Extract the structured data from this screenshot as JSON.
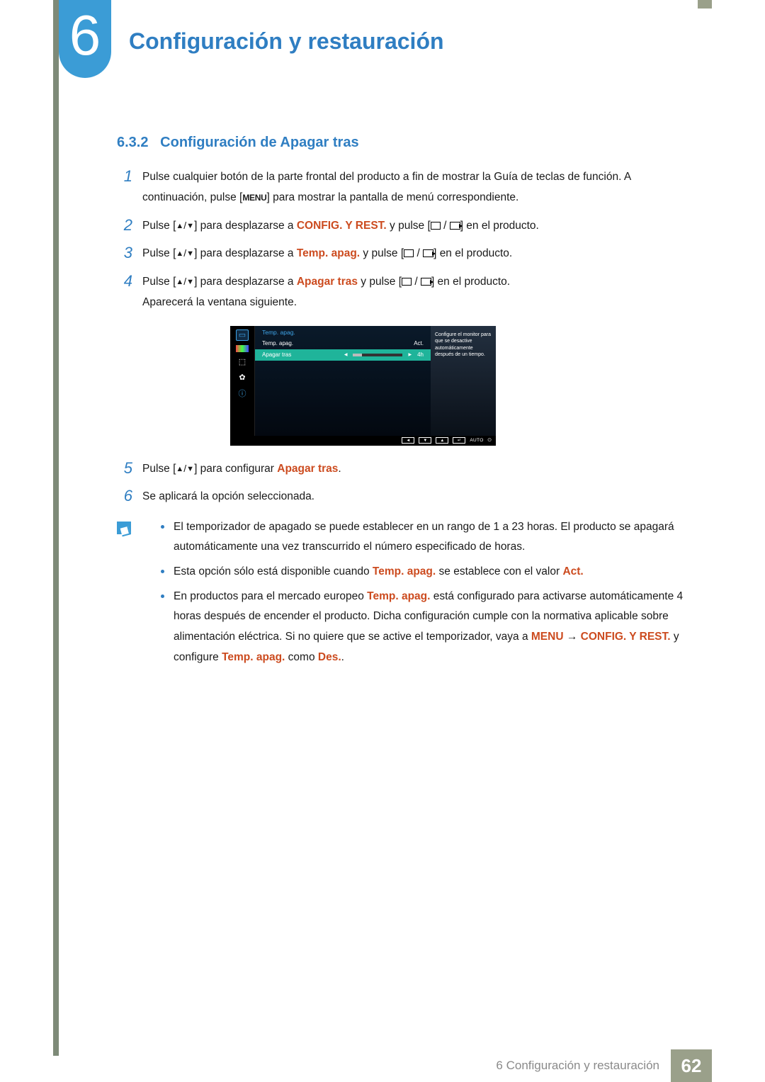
{
  "chapter": {
    "number": "6",
    "title": "Configuración y restauración"
  },
  "section": {
    "number": "6.3.2",
    "title": "Configuración de Apagar tras"
  },
  "labels": {
    "menu_key": "MENU",
    "arrow": " → "
  },
  "steps": {
    "s1": {
      "num": "1",
      "p1a": "Pulse cualquier botón de la parte frontal del producto a fin de mostrar la Guía de teclas de función. A continuación, pulse [",
      "p1b": "] para mostrar la pantalla de menú correspondiente."
    },
    "s2": {
      "num": "2",
      "a": "Pulse [",
      "b": "] para desplazarse a ",
      "target": "CONFIG. Y REST.",
      "c": " y pulse [",
      "d": "] en el producto."
    },
    "s3": {
      "num": "3",
      "a": "Pulse [",
      "b": "] para desplazarse a ",
      "target": "Temp. apag.",
      "c": " y pulse [",
      "d": "] en el producto."
    },
    "s4": {
      "num": "4",
      "a": "Pulse [",
      "b": "] para desplazarse a ",
      "target": "Apagar tras",
      "c": " y pulse [",
      "d": "] en el producto.",
      "trail": "Aparecerá la ventana siguiente."
    },
    "s5": {
      "num": "5",
      "a": "Pulse [",
      "b": "] para configurar ",
      "target": "Apagar tras",
      "c": "."
    },
    "s6": {
      "num": "6",
      "text": "Se aplicará la opción seleccionada."
    }
  },
  "osd": {
    "title": "Temp. apag.",
    "row1": {
      "label": "Temp. apag.",
      "value": "Act."
    },
    "row2": {
      "label": "Apagar tras",
      "value": "4h"
    },
    "side": "Configure el monitor para que se desactive automáticamente después de un tiempo.",
    "foot_auto": "AUTO"
  },
  "notes": {
    "n1": "El temporizador de apagado se puede establecer en un rango de 1 a 23 horas. El producto se apagará automáticamente una vez transcurrido el número especificado de horas.",
    "n2a": "Esta opción sólo está disponible cuando ",
    "n2t1": "Temp. apag.",
    "n2b": " se establece con el valor ",
    "n2t2": "Act.",
    "n3a": "En productos para el mercado europeo ",
    "n3t1": "Temp. apag.",
    "n3b": " está configurado para activarse automáticamente 4 horas después de encender el producto. Dicha configuración cumple con la normativa aplicable sobre alimentación eléctrica. Si no quiere que se active el temporizador, vaya a ",
    "n3menu": "MENU",
    "n3t2": "CONFIG. Y REST.",
    "n3c": " y configure ",
    "n3t3": "Temp. apag.",
    "n3d": " como ",
    "n3t4": "Des.",
    "n3e": "."
  },
  "footer": {
    "text": "6 Configuración y restauración",
    "page": "62"
  }
}
